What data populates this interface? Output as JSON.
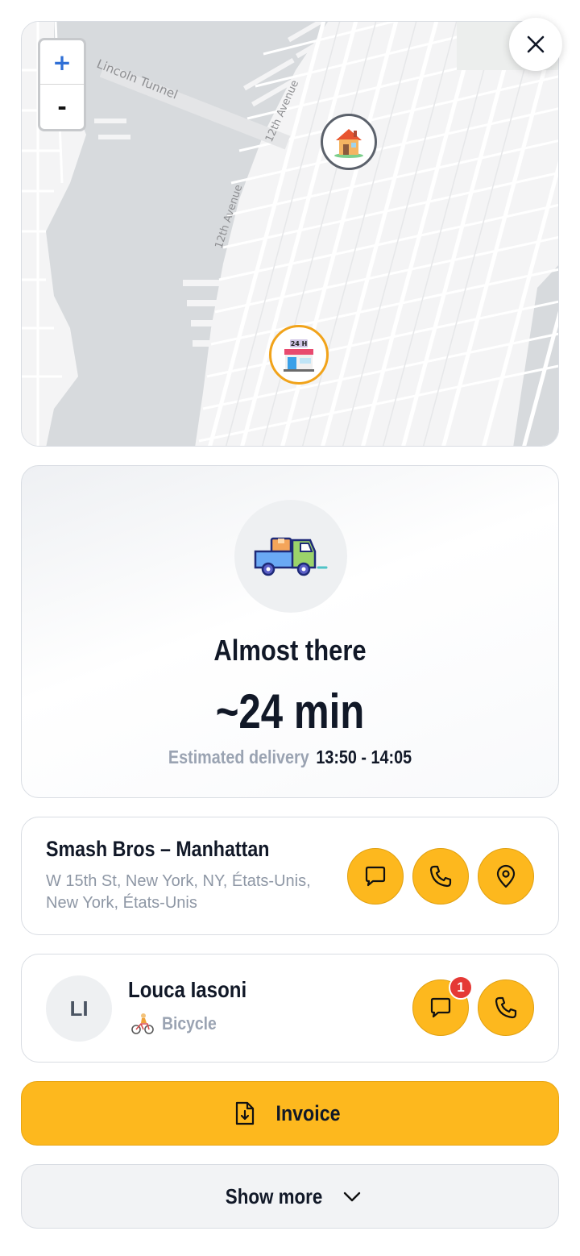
{
  "map": {
    "labels": {
      "tunnel": "Lincoln Tunnel",
      "avenue_upper": "12th Avenue",
      "avenue_lower": "12th Avenue"
    },
    "zoom_in": "+",
    "zoom_out": "-",
    "icons": {
      "destination": "house-icon",
      "origin": "store-24h-icon",
      "close": "close-icon"
    },
    "store_sign": "24 H"
  },
  "status": {
    "icon": "delivery-truck-icon",
    "title": "Almost there",
    "eta": "~24 min",
    "estimated_label": "Estimated delivery",
    "estimated_window": "13:50 - 14:05"
  },
  "restaurant": {
    "name": "Smash Bros – Manhattan",
    "address": "W 15th St, New York, NY, États-Unis, New York, États-Unis",
    "actions": [
      "chat-icon",
      "phone-icon",
      "map-pin-icon"
    ]
  },
  "courier": {
    "initials": "LI",
    "name": "Louca Iasoni",
    "vehicle_icon": "cyclist-icon",
    "vehicle": "Bicycle",
    "unread_messages": "1",
    "actions": [
      "chat-icon",
      "phone-icon"
    ]
  },
  "buttons": {
    "invoice": "Invoice",
    "show_more": "Show more"
  },
  "colors": {
    "accent": "#fdb81e",
    "badge": "#e53935",
    "muted_text": "#9aa3b2",
    "store_ring": "#f1a31a"
  }
}
